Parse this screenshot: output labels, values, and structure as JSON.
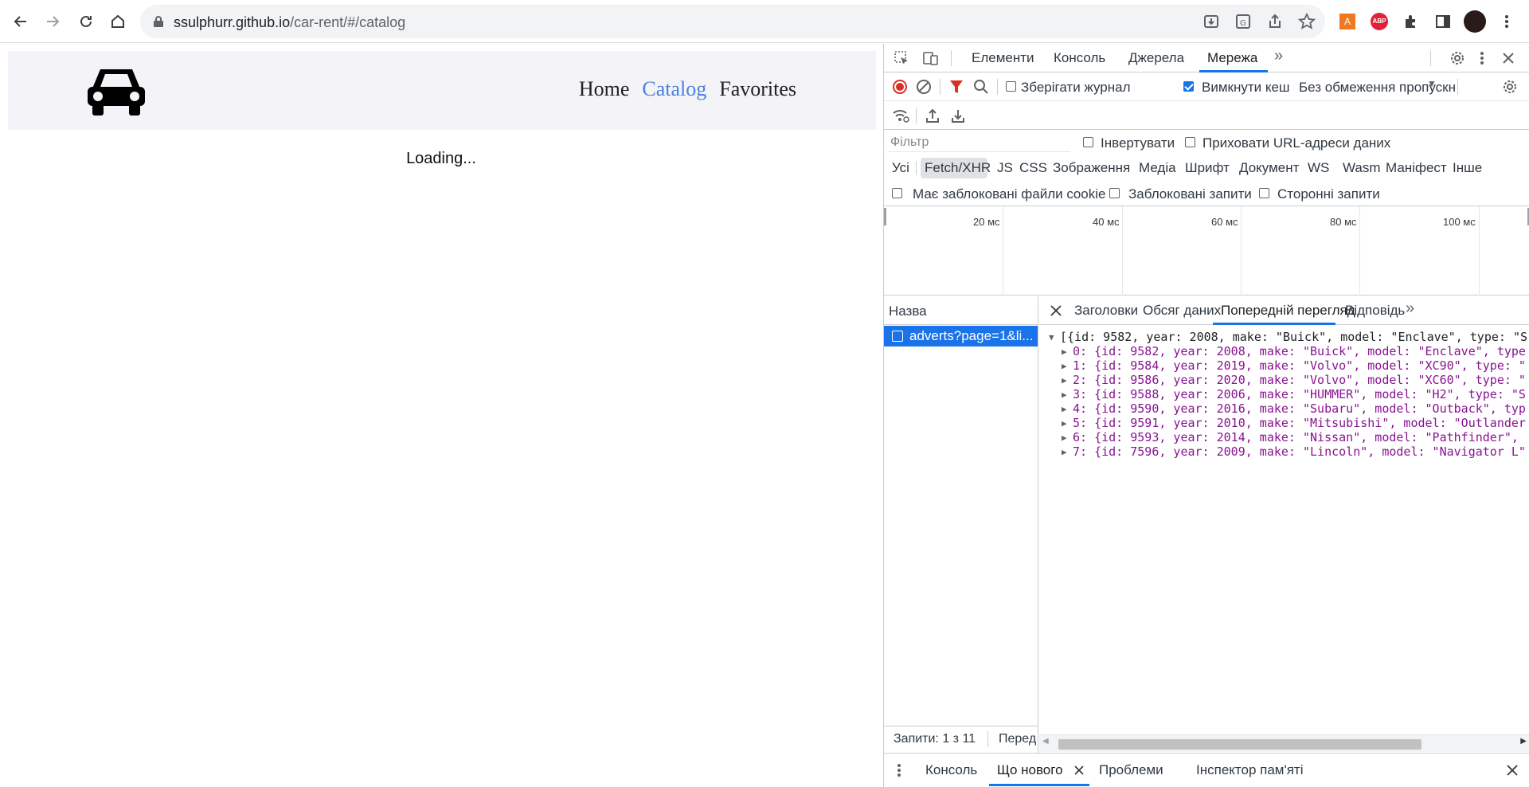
{
  "browser": {
    "url_host": "ssulphurr.github.io",
    "url_path": "/car-rent/#/catalog"
  },
  "site": {
    "nav": [
      "Home",
      "Catalog",
      "Favorites"
    ],
    "loading_text": "Loading..."
  },
  "devtools": {
    "tabs": [
      "Елементи",
      "Консоль",
      "Джерела",
      "Мережа"
    ],
    "active_tab": "Мережа",
    "toolbar": {
      "preserve_log_label": "Зберігати журнал",
      "preserve_log_checked": false,
      "disable_cache_label": "Вимкнути кеш",
      "disable_cache_checked": true,
      "throttling_label": "Без обмеження пропускн"
    },
    "filter": {
      "placeholder": "Фільтр",
      "invert_label": "Інвертувати",
      "hide_data_urls_label": "Приховати URL-адреси даних"
    },
    "type_filters": [
      "Усі",
      "Fetch/XHR",
      "JS",
      "CSS",
      "Зображення",
      "Медіа",
      "Шрифт",
      "Документ",
      "WS",
      "Wasm",
      "Маніфест",
      "Інше"
    ],
    "active_type_filter": "Fetch/XHR",
    "cookie_row": {
      "blocked_cookies_label": "Має заблоковані файли cookie",
      "blocked_requests_label": "Заблоковані запити",
      "third_party_label": "Сторонні запити"
    },
    "timeline_labels": [
      "20 мс",
      "40 мс",
      "60 мс",
      "80 мс",
      "100 мс"
    ],
    "request_list": {
      "header": "Назва",
      "rows": [
        "adverts?page=1&li..."
      ],
      "status": "Запити: 1 з 11",
      "status_cut": "Перед"
    },
    "detail_tabs": [
      "Заголовки",
      "Обсяг даних",
      "Попередній перегляд",
      "Відповідь"
    ],
    "active_detail_tab": "Попередній перегляд",
    "preview": {
      "root": "[{id: 9582, year: 2008, make: \"Buick\", model: \"Enclave\", type: \"S",
      "items": [
        "0: {id: 9582, year: 2008, make: \"Buick\", model: \"Enclave\", type",
        "1: {id: 9584, year: 2019, make: \"Volvo\", model: \"XC90\", type: \"",
        "2: {id: 9586, year: 2020, make: \"Volvo\", model: \"XC60\", type: \"",
        "3: {id: 9588, year: 2006, make: \"HUMMER\", model: \"H2\", type: \"S",
        "4: {id: 9590, year: 2016, make: \"Subaru\", model: \"Outback\", typ",
        "5: {id: 9591, year: 2010, make: \"Mitsubishi\", model: \"Outlander",
        "6: {id: 9593, year: 2014, make: \"Nissan\", model: \"Pathfinder\", ",
        "7: {id: 7596, year: 2009, make: \"Lincoln\", model: \"Navigator L\""
      ]
    },
    "drawer_tabs": [
      "Консоль",
      "Що нового",
      "Проблеми",
      "Інспектор пам'яті"
    ],
    "active_drawer_tab": "Що нового"
  }
}
